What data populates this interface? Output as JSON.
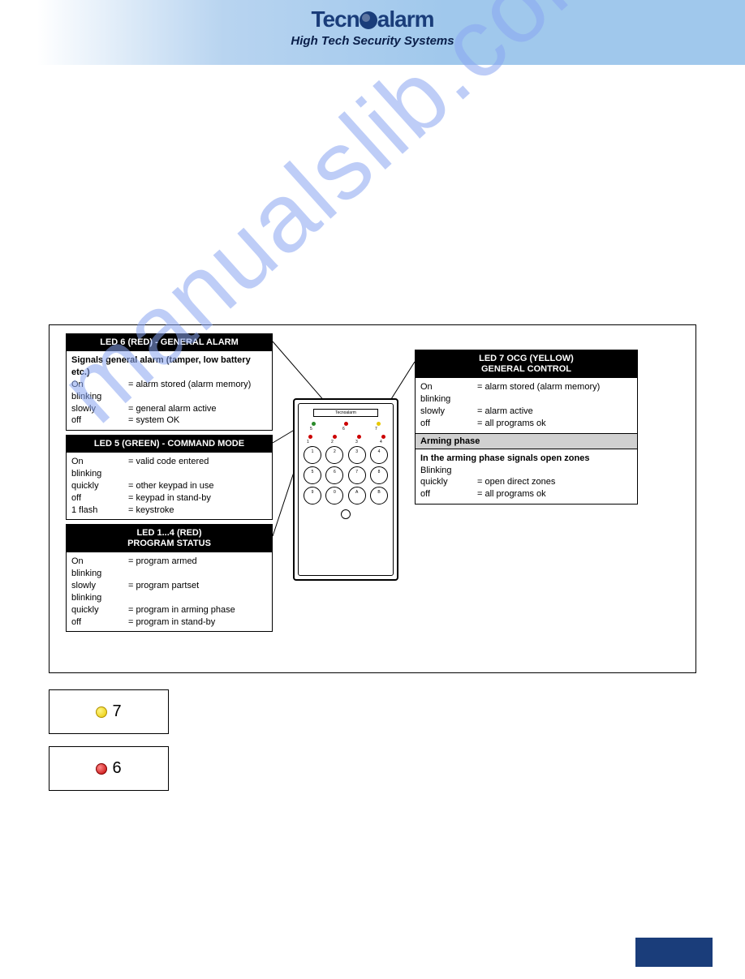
{
  "header": {
    "brand_part1": "Tecn",
    "brand_part2": "alarm",
    "tagline": "High Tech Security Systems"
  },
  "device_brand": "Tecnoalarm",
  "box_led6": {
    "title": "LED 6 (RED) - GENERAL ALARM",
    "intro": "Signals general alarm (tamper, low battery etc.)",
    "rows": [
      {
        "s": "On",
        "d": "= alarm stored (alarm memory)"
      },
      {
        "s": "blinking",
        "d": ""
      },
      {
        "s": "slowly",
        "d": "= general alarm active"
      },
      {
        "s": "off",
        "d": "= system OK"
      }
    ]
  },
  "box_led5": {
    "title": "LED 5 (GREEN) - COMMAND MODE",
    "rows": [
      {
        "s": "On",
        "d": "= valid code entered"
      },
      {
        "s": "blinking",
        "d": ""
      },
      {
        "s": "quickly",
        "d": "= other keypad in use"
      },
      {
        "s": "off",
        "d": "= keypad in stand-by"
      },
      {
        "s": "1 flash",
        "d": "= keystroke"
      }
    ]
  },
  "box_led14": {
    "title_l1": "LED 1...4 (RED)",
    "title_l2": "PROGRAM STATUS",
    "rows": [
      {
        "s": "On",
        "d": "= program armed"
      },
      {
        "s": "blinking",
        "d": ""
      },
      {
        "s": "slowly",
        "d": "= program partset"
      },
      {
        "s": "blinking",
        "d": ""
      },
      {
        "s": "quickly",
        "d": "= program in arming phase"
      },
      {
        "s": "off",
        "d": "= program in stand-by"
      }
    ]
  },
  "box_led7": {
    "title_l1": "LED 7 OCG (YELLOW)",
    "title_l2": "GENERAL CONTROL",
    "rows_a": [
      {
        "s": "On",
        "d": "= alarm stored (alarm memory)"
      },
      {
        "s": "blinking",
        "d": ""
      },
      {
        "s": "slowly",
        "d": "= alarm active"
      },
      {
        "s": "off",
        "d": "= all programs ok"
      }
    ],
    "sub": "Arming phase",
    "intro2": "In the arming phase signals open zones",
    "rows_b": [
      {
        "s": "Blinking",
        "d": ""
      },
      {
        "s": "quickly",
        "d": "= open direct zones"
      },
      {
        "s": "off",
        "d": "= all programs ok"
      }
    ]
  },
  "keypad_rows": [
    [
      "1",
      "2",
      "3",
      "4"
    ],
    [
      "5",
      "6",
      "7",
      "8"
    ],
    [
      "9",
      "0",
      "A",
      "B"
    ]
  ],
  "led_top_nums": [
    "5",
    "6",
    "7"
  ],
  "led_row2_nums": [
    "1",
    "2",
    "3",
    "4"
  ],
  "legend7": "7",
  "legend6": "6",
  "watermark": "manualslib.com"
}
